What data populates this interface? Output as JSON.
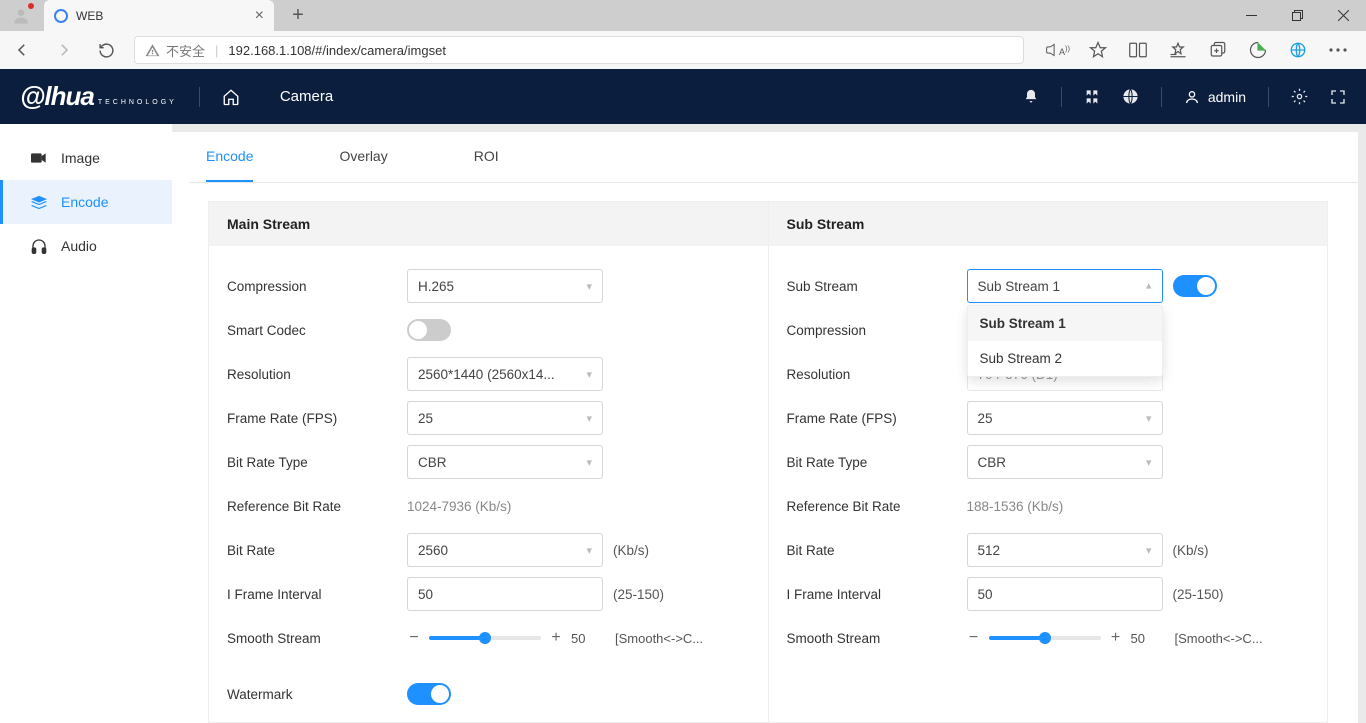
{
  "browser": {
    "tab_title": "WEB",
    "address_label": "不安全",
    "url": "192.168.1.108/#/index/camera/imgset"
  },
  "topbar": {
    "section": "Camera",
    "user": "admin"
  },
  "sidebar": {
    "items": [
      {
        "label": "Image"
      },
      {
        "label": "Encode"
      },
      {
        "label": "Audio"
      }
    ]
  },
  "tabs": {
    "items": [
      {
        "label": "Encode"
      },
      {
        "label": "Overlay"
      },
      {
        "label": "ROI"
      }
    ]
  },
  "main_stream": {
    "title": "Main Stream",
    "labels": {
      "compression": "Compression",
      "smart_codec": "Smart Codec",
      "resolution": "Resolution",
      "frame_rate": "Frame Rate (FPS)",
      "bit_rate_type": "Bit Rate Type",
      "ref_bit_rate": "Reference Bit Rate",
      "bit_rate": "Bit Rate",
      "i_frame": "I Frame Interval",
      "smooth": "Smooth Stream",
      "watermark": "Watermark"
    },
    "values": {
      "compression": "H.265",
      "resolution": "2560*1440 (2560x14...",
      "frame_rate": "25",
      "bit_rate_type": "CBR",
      "ref_bit_rate": "1024-7936 (Kb/s)",
      "bit_rate": "2560",
      "bit_rate_unit": "(Kb/s)",
      "i_frame": "50",
      "i_frame_range": "(25-150)",
      "smooth_value": "50",
      "smooth_caption": "[Smooth<->C..."
    }
  },
  "sub_stream": {
    "title": "Sub Stream",
    "labels": {
      "sub_stream": "Sub Stream",
      "compression": "Compression",
      "resolution": "Resolution",
      "frame_rate": "Frame Rate (FPS)",
      "bit_rate_type": "Bit Rate Type",
      "ref_bit_rate": "Reference Bit Rate",
      "bit_rate": "Bit Rate",
      "i_frame": "I Frame Interval",
      "smooth": "Smooth Stream"
    },
    "values": {
      "sub_stream": "Sub Stream 1",
      "resolution": "704*576 (D1)",
      "frame_rate": "25",
      "bit_rate_type": "CBR",
      "ref_bit_rate": "188-1536 (Kb/s)",
      "bit_rate": "512",
      "bit_rate_unit": "(Kb/s)",
      "i_frame": "50",
      "i_frame_range": "(25-150)",
      "smooth_value": "50",
      "smooth_caption": "[Smooth<->C..."
    },
    "dropdown_options": [
      "Sub Stream 1",
      "Sub Stream 2"
    ]
  }
}
